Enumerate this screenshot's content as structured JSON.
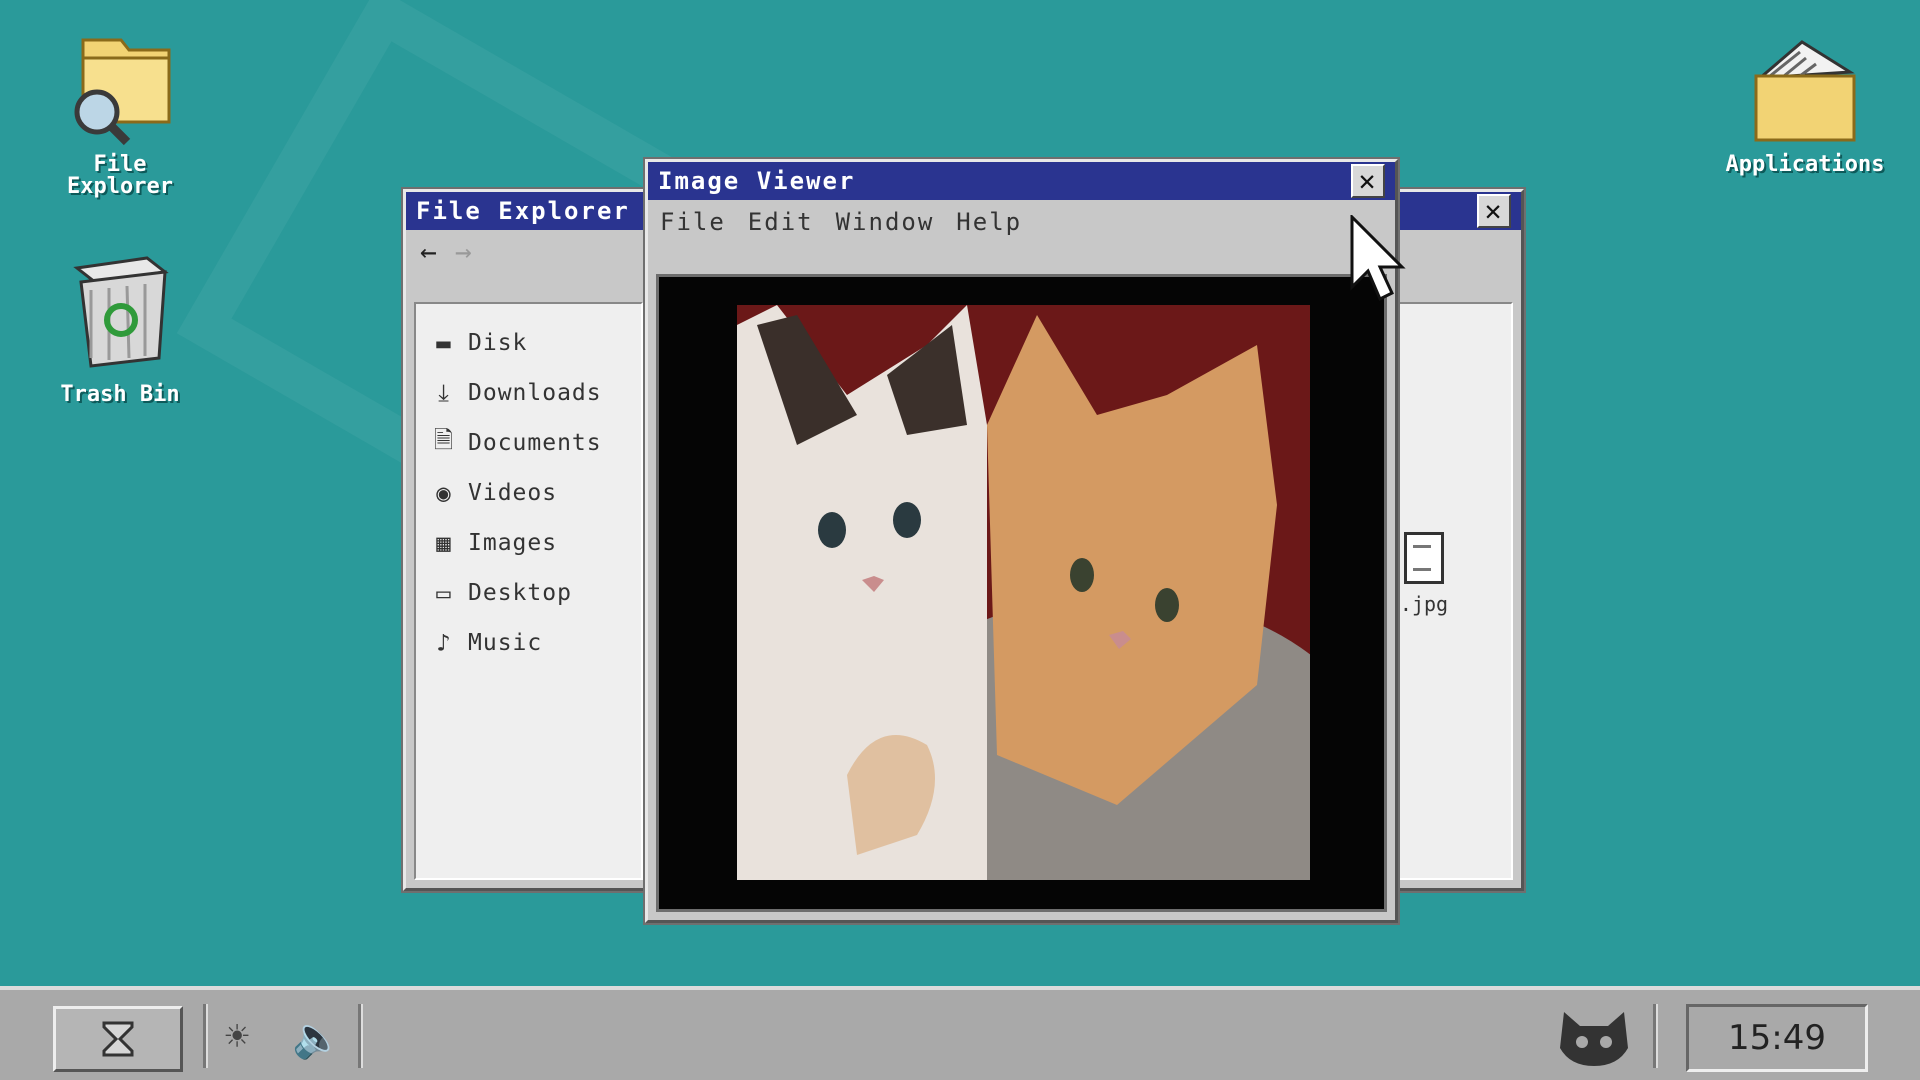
{
  "desktop": {
    "icons": [
      {
        "label": "File\nExplorer"
      },
      {
        "label": "Trash Bin"
      },
      {
        "label": "Applications"
      }
    ]
  },
  "file_explorer": {
    "title": "File Explorer",
    "sidebar": [
      {
        "label": "Disk",
        "icon": "disk-icon"
      },
      {
        "label": "Downloads",
        "icon": "download-icon"
      },
      {
        "label": "Documents",
        "icon": "document-icon"
      },
      {
        "label": "Videos",
        "icon": "video-icon"
      },
      {
        "label": "Images",
        "icon": "image-icon"
      },
      {
        "label": "Desktop",
        "icon": "monitor-icon"
      },
      {
        "label": "Music",
        "icon": "music-note-icon"
      }
    ],
    "file": {
      "label": ".jpg"
    }
  },
  "image_viewer": {
    "title": "Image Viewer",
    "menu": [
      "File",
      "Edit",
      "Window",
      "Help"
    ]
  },
  "taskbar": {
    "clock": "15:49"
  },
  "colors": {
    "desktop": "#2a9a9a",
    "titlebar": "#2a3490",
    "window": "#c8c8c8"
  }
}
